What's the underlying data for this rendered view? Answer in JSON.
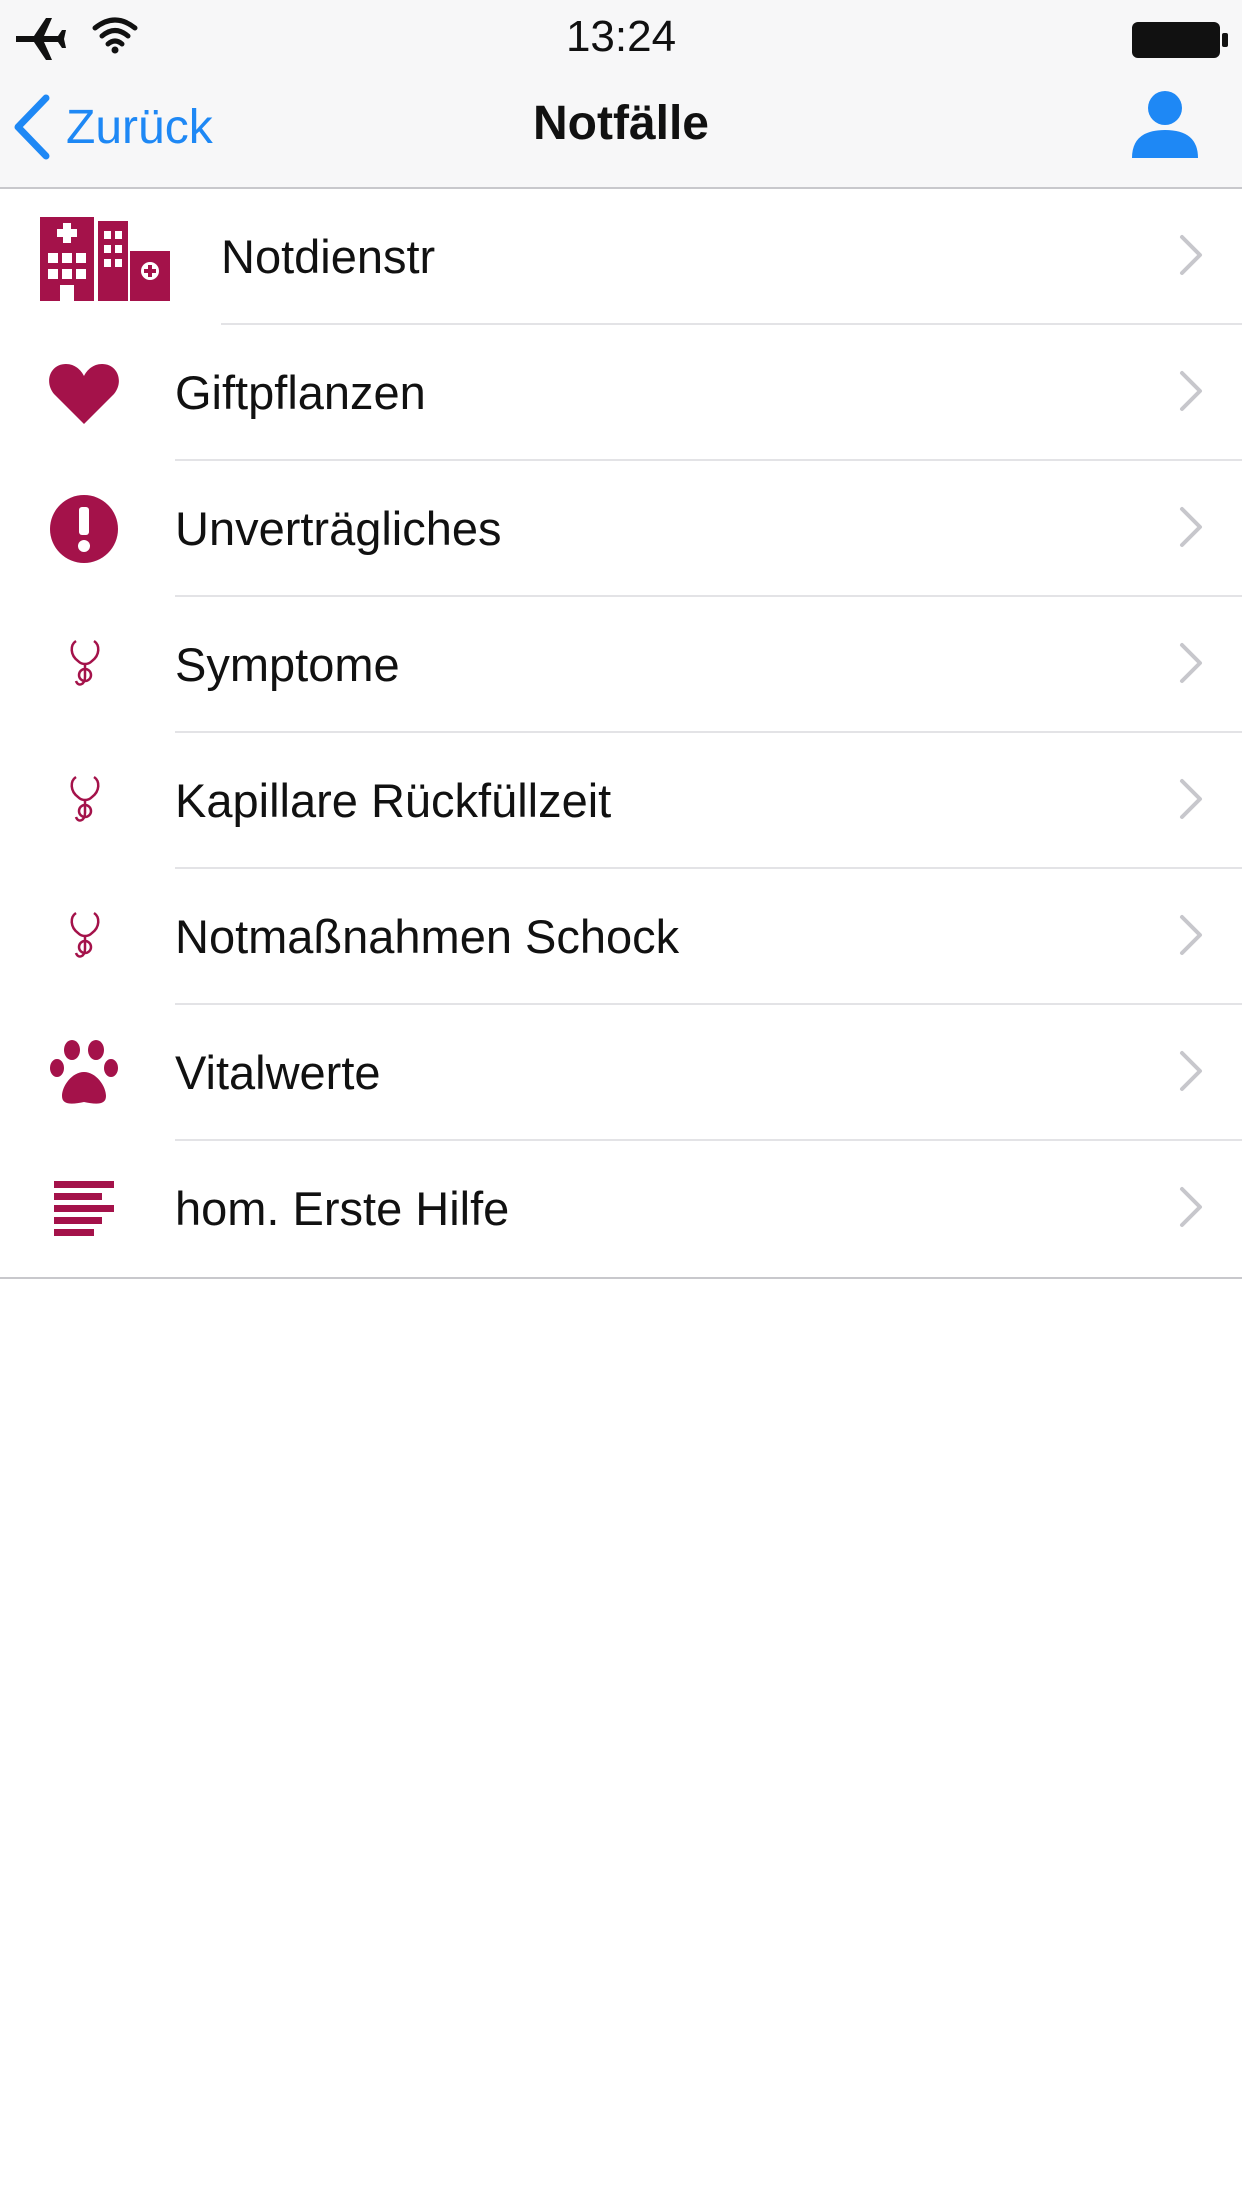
{
  "status_bar": {
    "time": "13:24",
    "icons": [
      "airplane-icon",
      "wifi-icon",
      "battery-icon"
    ]
  },
  "nav": {
    "back_label": "Zurück",
    "title": "Notfälle",
    "right_icon": "profile-icon"
  },
  "colors": {
    "accent": "#1e88f5",
    "icon_maroon": "#a4124a",
    "separator": "#e3e3e6"
  },
  "items": [
    {
      "label": "Notdienstr",
      "icon": "hospital-icon"
    },
    {
      "label": "Giftpflanzen",
      "icon": "heart-icon"
    },
    {
      "label": "Unverträgliches",
      "icon": "alert-icon"
    },
    {
      "label": "Symptome",
      "icon": "stethoscope-icon"
    },
    {
      "label": "Kapillare Rückfüllzeit",
      "icon": "stethoscope-icon"
    },
    {
      "label": "Notmaßnahmen Schock",
      "icon": "stethoscope-icon"
    },
    {
      "label": "Vitalwerte",
      "icon": "paw-icon"
    },
    {
      "label": "hom. Erste Hilfe",
      "icon": "text-lines-icon"
    }
  ]
}
